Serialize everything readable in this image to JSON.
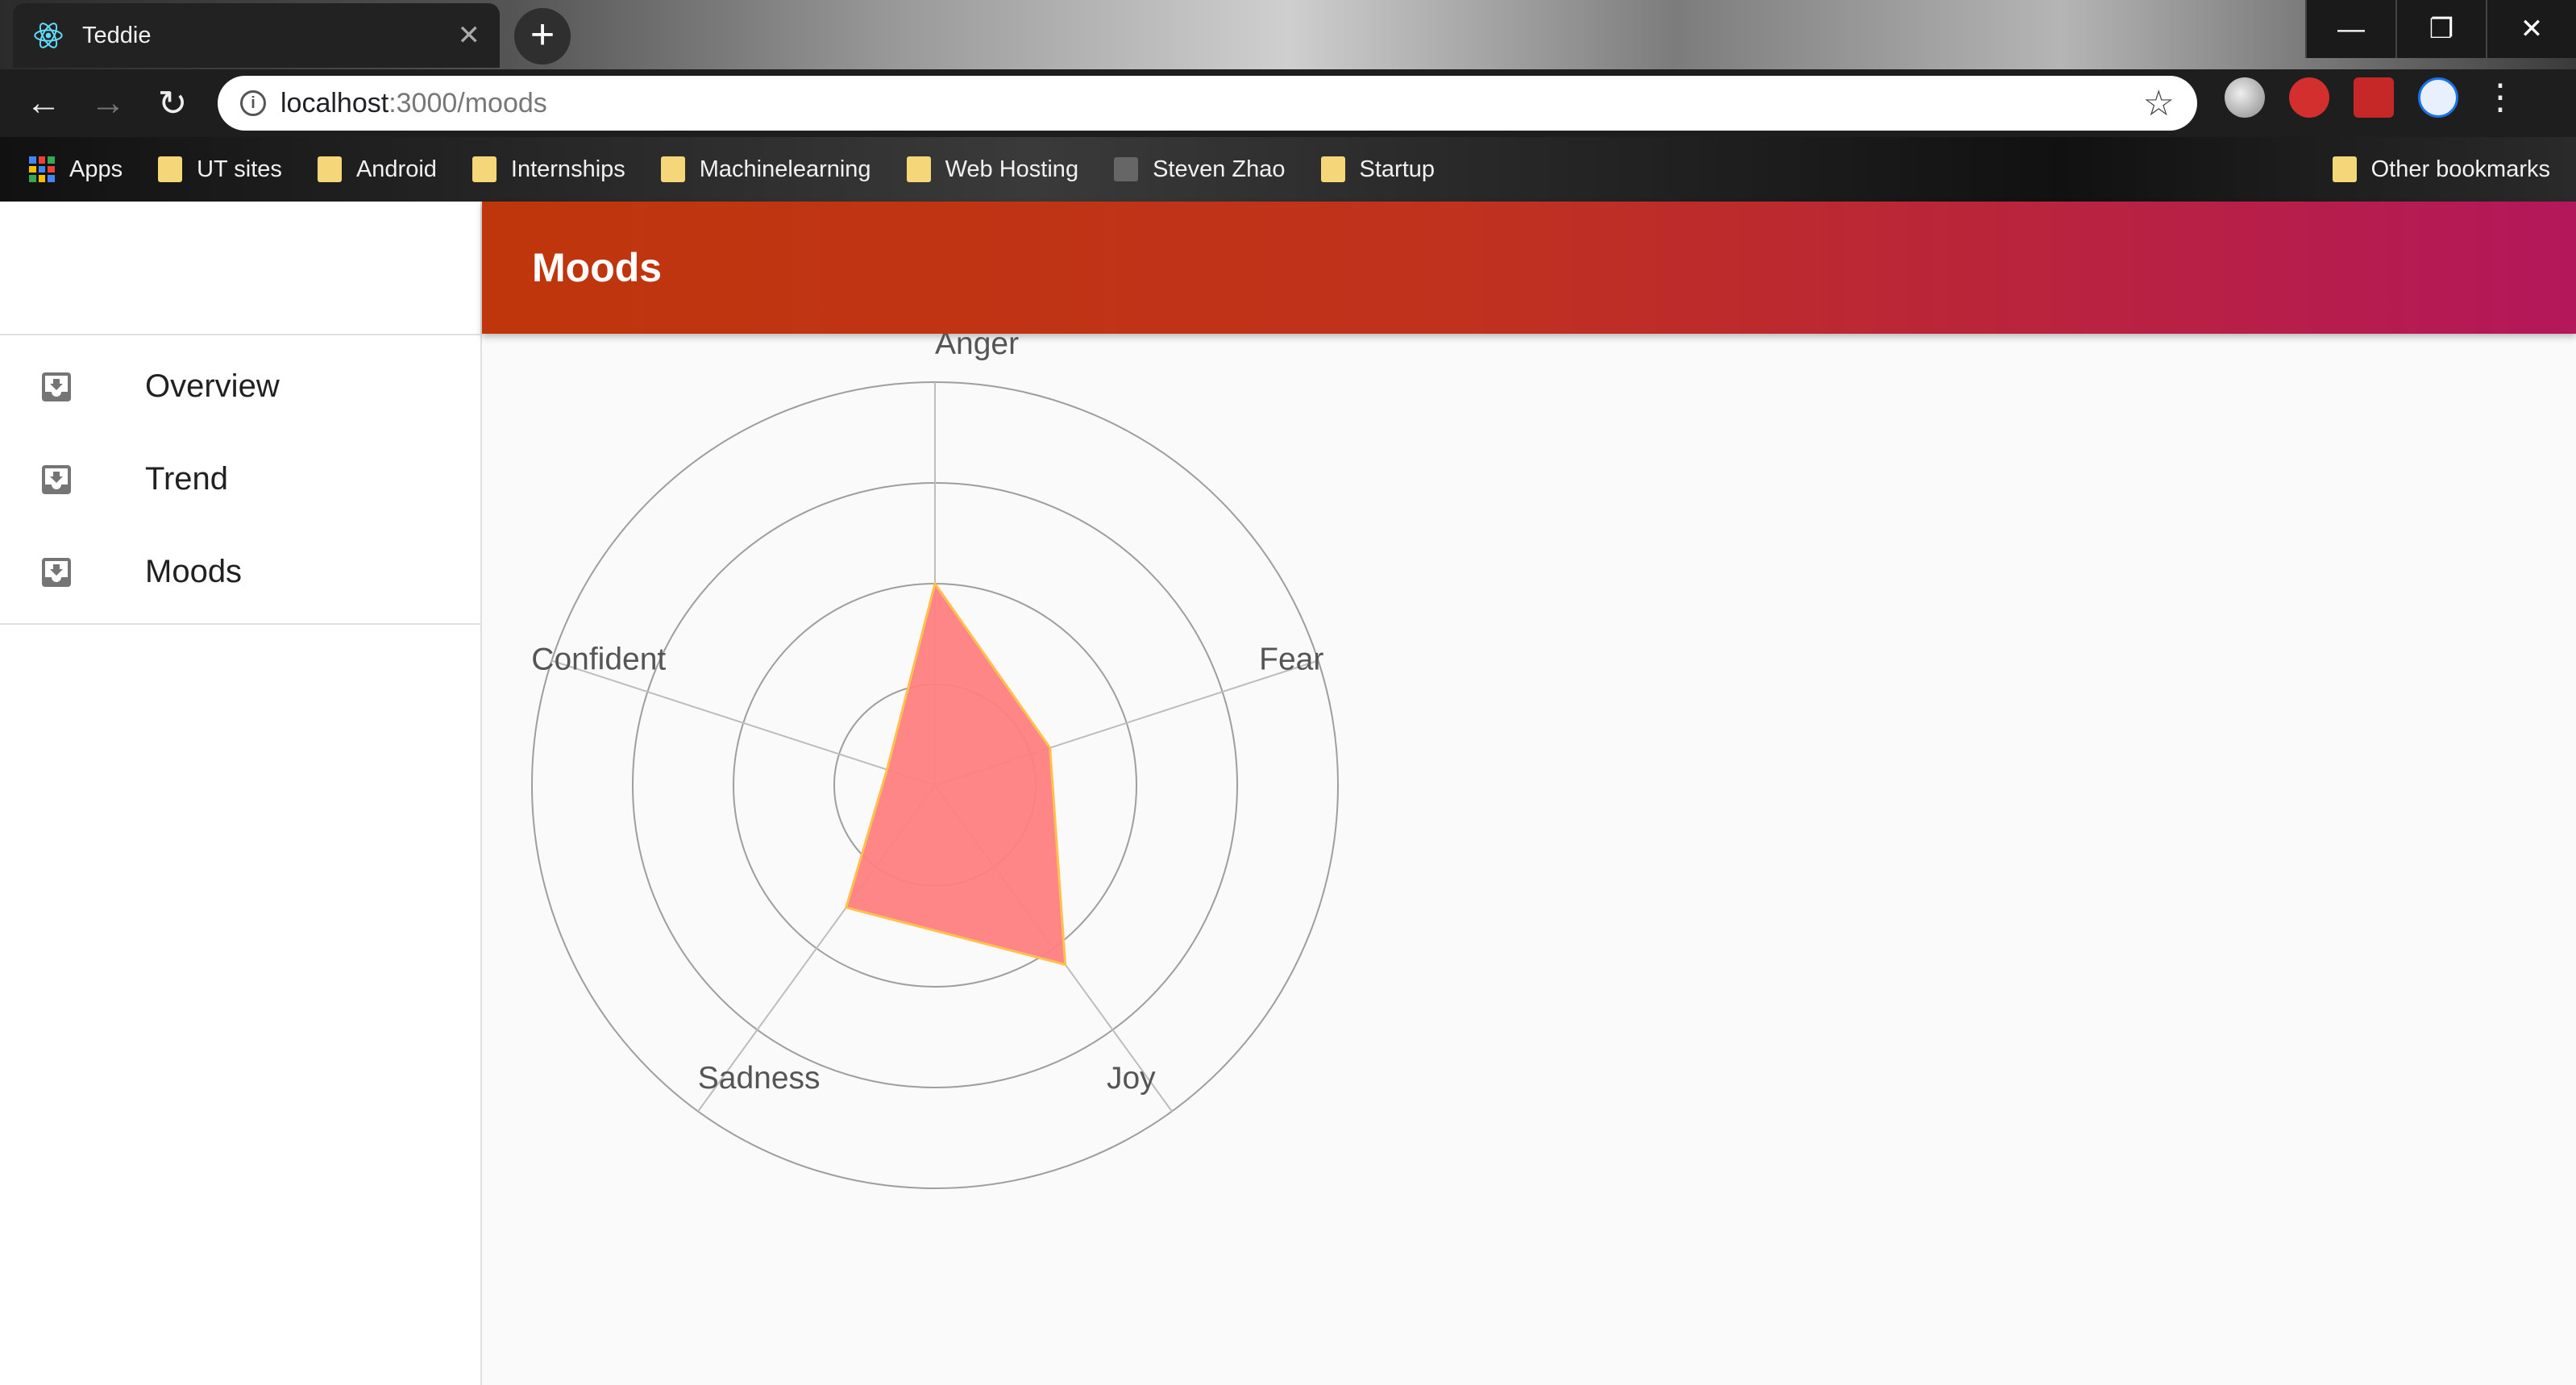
{
  "browser": {
    "tab_title": "Teddie",
    "new_tab_symbol": "+",
    "tab_close_symbol": "✕",
    "url_host": "localhost",
    "url_path": ":3000/moods",
    "bookmarks": [
      {
        "label": "Apps",
        "icon": "apps-icon"
      },
      {
        "label": "UT sites",
        "icon": "folder-icon"
      },
      {
        "label": "Android",
        "icon": "folder-icon"
      },
      {
        "label": "Internships",
        "icon": "folder-icon"
      },
      {
        "label": "Machinelearning",
        "icon": "folder-icon"
      },
      {
        "label": "Web Hosting",
        "icon": "folder-icon"
      },
      {
        "label": "Steven Zhao",
        "icon": "page-icon"
      },
      {
        "label": "Startup",
        "icon": "folder-icon"
      }
    ],
    "other_bookmarks": "Other bookmarks"
  },
  "app": {
    "title": "Moods",
    "nav": [
      {
        "label": "Overview",
        "icon": "inbox-icon"
      },
      {
        "label": "Trend",
        "icon": "inbox-icon"
      },
      {
        "label": "Moods",
        "icon": "inbox-icon"
      }
    ]
  },
  "chart_data": {
    "type": "radar",
    "axes": [
      "Anger",
      "Fear",
      "Joy",
      "Sadness",
      "Confident"
    ],
    "values": [
      2.0,
      1.2,
      2.2,
      1.5,
      0.5
    ],
    "rmax": 4,
    "rings": [
      1,
      2,
      3,
      4
    ],
    "fill_color": "#ff7f7f",
    "stroke_color": "#ffc04d",
    "grid": true
  }
}
